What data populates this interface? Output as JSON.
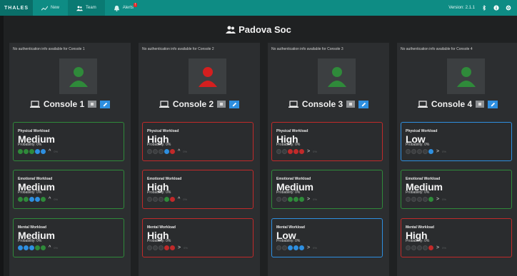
{
  "topbar": {
    "brand": "THALES",
    "nav": [
      {
        "label": "New",
        "icon": "chart-icon",
        "active": false
      },
      {
        "label": "Team",
        "icon": "team-icon",
        "active": true
      },
      {
        "label": "Alerts",
        "icon": "alert-icon",
        "active": false,
        "badge": "!"
      }
    ],
    "version": "Version: 2.1.1",
    "icons": [
      "bluetooth-icon",
      "info-icon",
      "settings-icon"
    ]
  },
  "page": {
    "title": "Padova Soc"
  },
  "colors": {
    "topbar": "#0e8c84",
    "green": "#2f8a3a",
    "red": "#c12a2a",
    "blue": "#2e8fe0",
    "panel": "#2c2e30"
  },
  "consoles": [
    {
      "auth_note": "No authentication info available for Console 1",
      "name": "Console 1",
      "avatar_color": "#2f8a3a",
      "cards": [
        {
          "label": "Physical Workload",
          "level": "Medium",
          "probability": "Probability: 0%",
          "border": "green",
          "dots": [
            "#2f8a3a",
            "#2f8a3a",
            "#2f8a3a",
            "#2e8fe0",
            "#2e8fe0"
          ],
          "trend": "^",
          "faint": "0%"
        },
        {
          "label": "Emotional Workload",
          "level": "Medium",
          "probability": "Probability: 0%",
          "border": "green",
          "dots": [
            "#2f8a3a",
            "#2f8a3a",
            "#2e8fe0",
            "#2e8fe0",
            "#2f8a3a"
          ],
          "trend": "^",
          "faint": "0%"
        },
        {
          "label": "Mental Workload",
          "level": "Medium",
          "probability": "Probability: 0%",
          "border": "green",
          "dots": [
            "#2e8fe0",
            "#2e8fe0",
            "#2e8fe0",
            "#2f8a3a",
            "#2f8a3a"
          ],
          "trend": "^",
          "faint": "0%"
        }
      ]
    },
    {
      "auth_note": "No authentication info available for Console 2",
      "name": "Console 2",
      "avatar_color": "#d41f1f",
      "cards": [
        {
          "label": "Physical Workload",
          "level": "High",
          "probability": "Probability: 0%",
          "border": "red",
          "dots": [
            "",
            "",
            "",
            "#2e8fe0",
            "#c12a2a"
          ],
          "trend": "^",
          "faint": "0%"
        },
        {
          "label": "Emotional Workload",
          "level": "High",
          "probability": "Probability: 0%",
          "border": "red",
          "dots": [
            "",
            "",
            "",
            "#2f8a3a",
            "#c12a2a"
          ],
          "trend": "^",
          "faint": "0%"
        },
        {
          "label": "Mental Workload",
          "level": "High",
          "probability": "Probability: 0%",
          "border": "red",
          "dots": [
            "",
            "",
            "",
            "#c12a2a",
            "#c12a2a"
          ],
          "trend": ">",
          "faint": "0%"
        }
      ]
    },
    {
      "auth_note": "No authentication info available for Console 3",
      "name": "Console 3",
      "avatar_color": "#2f8a3a",
      "cards": [
        {
          "label": "Physical Workload",
          "level": "High",
          "probability": "Probability: 0%",
          "border": "red",
          "dots": [
            "",
            "",
            "#c12a2a",
            "#c12a2a",
            "#c12a2a"
          ],
          "trend": ">",
          "faint": "0%"
        },
        {
          "label": "Emotional Workload",
          "level": "Medium",
          "probability": "Probability: 0%",
          "border": "green",
          "dots": [
            "",
            "",
            "#2f8a3a",
            "#2f8a3a",
            "#2f8a3a"
          ],
          "trend": ">",
          "faint": "0%"
        },
        {
          "label": "Mental Workload",
          "level": "Low",
          "probability": "Probability: 0%",
          "border": "blue",
          "dots": [
            "",
            "",
            "#2e8fe0",
            "#2e8fe0",
            "#2e8fe0"
          ],
          "trend": ">",
          "faint": "0%"
        }
      ]
    },
    {
      "auth_note": "No authentication info available for Console 4",
      "name": "Console 4",
      "avatar_color": "#2f8a3a",
      "cards": [
        {
          "label": "Physical Workload",
          "level": "Low",
          "probability": "Probability: 0%",
          "border": "blue",
          "dots": [
            "",
            "",
            "",
            "",
            "#2e8fe0"
          ],
          "trend": ">",
          "faint": "0%"
        },
        {
          "label": "Emotional Workload",
          "level": "Medium",
          "probability": "Probability: 0%",
          "border": "green",
          "dots": [
            "",
            "",
            "",
            "",
            "#2f8a3a"
          ],
          "trend": ">",
          "faint": "0%"
        },
        {
          "label": "Mental Workload",
          "level": "High",
          "probability": "Probability: 0%",
          "border": "red",
          "dots": [
            "",
            "",
            "",
            "",
            "#c12a2a"
          ],
          "trend": ">",
          "faint": "0%"
        }
      ]
    }
  ]
}
